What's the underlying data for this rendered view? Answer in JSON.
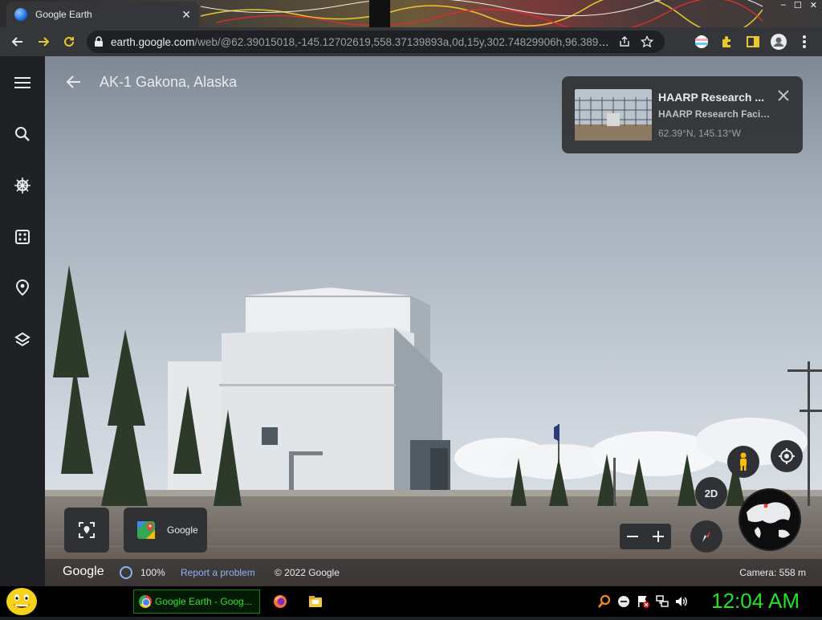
{
  "browser": {
    "tab_title": "Google Earth",
    "tab_close": "✕",
    "window_controls": [
      "–",
      "☐",
      "✕"
    ],
    "url_host": "earth.google.com",
    "url_path": "/web/@62.39015018,-145.12702619,558.37139893a,0d,15y,302.74829906h,96.38933..."
  },
  "header": {
    "title": "AK-1 Gakona, Alaska"
  },
  "rail": {
    "items": [
      "menu",
      "search",
      "voyager",
      "feeling-lucky",
      "projects",
      "map-style"
    ]
  },
  "card": {
    "title": "HAARP Research ...",
    "subtitle": "HAARP Research Facili...",
    "coords": "62.39°N, 145.13°W"
  },
  "bottom_buttons": {
    "google_label": "Google",
    "mode_2d": "2D"
  },
  "status": {
    "logo": "Google",
    "load_percent": "100%",
    "report": "Report a problem",
    "copyright": "© 2022 Google",
    "camera": "Camera: 558 m"
  },
  "taskbar": {
    "window_label": "Google Earth - Goog...",
    "clock": "12:04 AM"
  },
  "colors": {
    "accent": "#8ab4f8",
    "sky_top": "#8c96a2",
    "sky_bottom": "#dfe4ea",
    "clock_green": "#22e422"
  }
}
